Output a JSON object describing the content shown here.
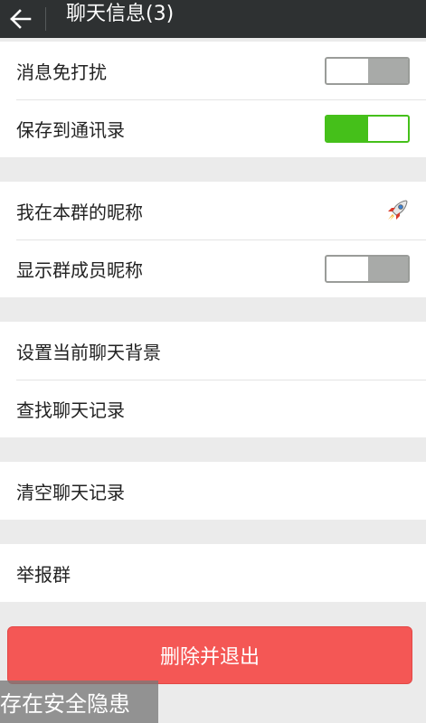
{
  "header": {
    "back_icon": "back-arrow-icon",
    "title": "聊天信息(3)"
  },
  "settings": {
    "mute": {
      "label": "消息免打扰",
      "state": "off"
    },
    "save_contacts": {
      "label": "保存到通讯录",
      "state": "on"
    },
    "my_alias": {
      "label": "我在本群的昵称",
      "icon": "rocket-icon"
    },
    "show_member_alias": {
      "label": "显示群成员昵称",
      "state": "off"
    },
    "background": {
      "label": "设置当前聊天背景"
    },
    "search_history": {
      "label": "查找聊天记录"
    },
    "clear_history": {
      "label": "清空聊天记录"
    },
    "report": {
      "label": "举报群"
    }
  },
  "delete_button": {
    "label": "删除并退出"
  },
  "watermark": {
    "text": "存在安全隐患"
  },
  "colors": {
    "topbar": "#2e3132",
    "switch_on": "#45c01a",
    "switch_off": "#a8aaa8",
    "danger": "#f45755",
    "background": "#ebebeb"
  }
}
